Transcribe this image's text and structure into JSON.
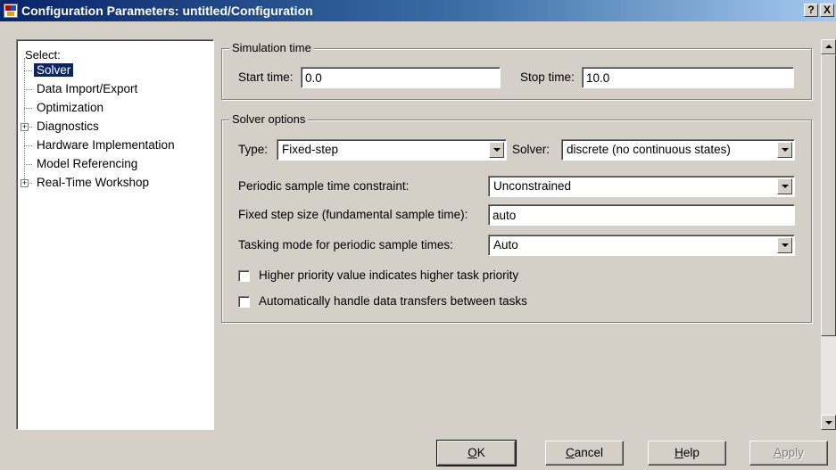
{
  "window": {
    "title": "Configuration Parameters: untitled/Configuration",
    "help_glyph": "?",
    "close_glyph": "X"
  },
  "tree": {
    "header": "Select:",
    "items": [
      {
        "label": "Solver",
        "selected": true,
        "expandable": false
      },
      {
        "label": "Data Import/Export",
        "selected": false,
        "expandable": false
      },
      {
        "label": "Optimization",
        "selected": false,
        "expandable": false
      },
      {
        "label": "Diagnostics",
        "selected": false,
        "expandable": true
      },
      {
        "label": "Hardware Implementation",
        "selected": false,
        "expandable": false
      },
      {
        "label": "Model Referencing",
        "selected": false,
        "expandable": false
      },
      {
        "label": "Real-Time Workshop",
        "selected": false,
        "expandable": true
      }
    ],
    "expand_glyph": "+"
  },
  "simulation_time": {
    "group_title": "Simulation time",
    "start_label": "Start time:",
    "start_value": "0.0",
    "stop_label": "Stop time:",
    "stop_value": "10.0"
  },
  "solver_options": {
    "group_title": "Solver options",
    "type_label": "Type:",
    "type_value": "Fixed-step",
    "solver_label": "Solver:",
    "solver_value": "discrete (no continuous states)",
    "periodic_label": "Periodic sample time constraint:",
    "periodic_value": "Unconstrained",
    "step_size_label": "Fixed step size (fundamental sample time):",
    "step_size_value": "auto",
    "tasking_label": "Tasking mode for periodic sample times:",
    "tasking_value": "Auto",
    "check_priority_label": "Higher priority value indicates higher task priority",
    "check_priority_checked": false,
    "check_transfers_label": "Automatically handle data transfers between tasks",
    "check_transfers_checked": false
  },
  "buttons": {
    "ok": {
      "accel": "O",
      "rest": "K"
    },
    "cancel": {
      "accel": "C",
      "rest": "ancel"
    },
    "help": {
      "accel": "H",
      "rest": "elp"
    },
    "apply": {
      "accel": "A",
      "rest": "pply"
    }
  }
}
